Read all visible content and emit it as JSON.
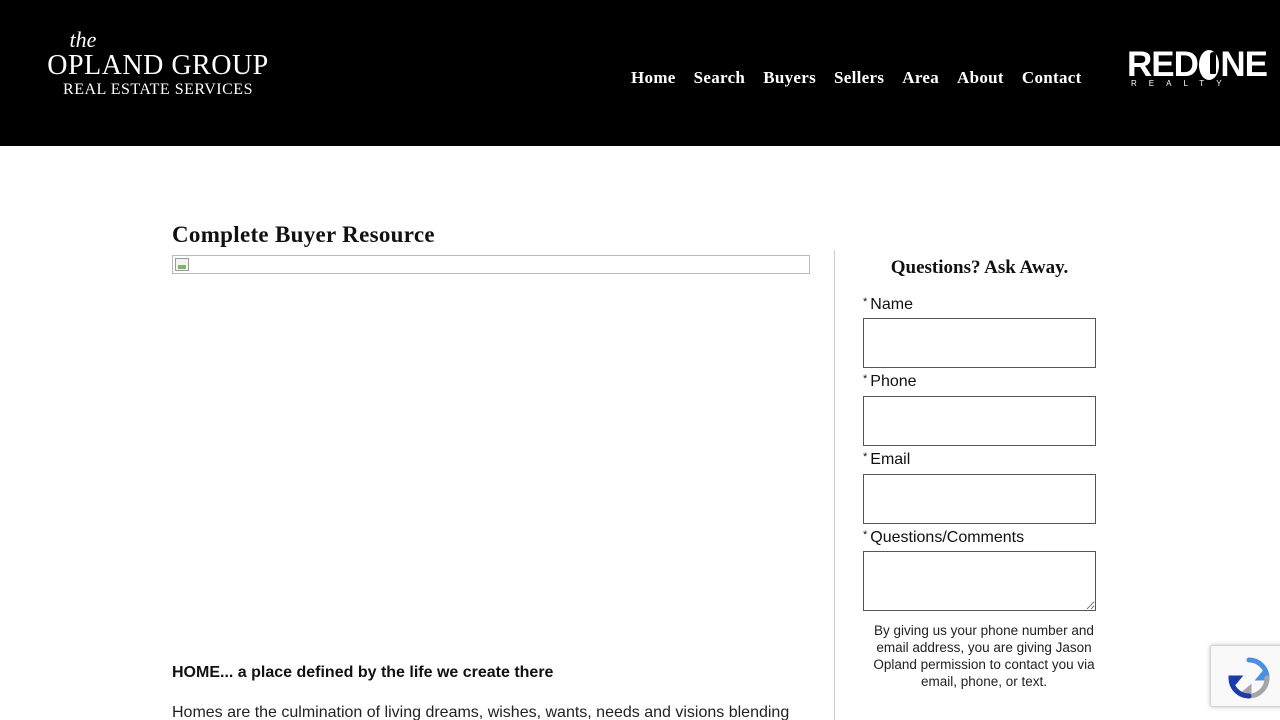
{
  "header": {
    "logo": {
      "line1": "the",
      "line2": "OPLAND GROUP",
      "line3": "REAL ESTATE SERVICES"
    },
    "nav": [
      {
        "label": "Home"
      },
      {
        "label": "Search"
      },
      {
        "label": "Buyers"
      },
      {
        "label": "Sellers"
      },
      {
        "label": "Area"
      },
      {
        "label": "About"
      },
      {
        "label": "Contact"
      }
    ],
    "brand": {
      "word_left": "RED",
      "word_right": "NE",
      "sub": "REALTY"
    }
  },
  "main": {
    "title": "Complete Buyer Resource",
    "heading": "HOME... a place defined by the life we create there",
    "paragraph": "Homes are the culmination of living dreams, wishes, wants, needs and visions blending"
  },
  "sidebar": {
    "title": "Questions? Ask Away.",
    "required_marker": "*",
    "fields": [
      {
        "label": "Name",
        "value": ""
      },
      {
        "label": "Phone",
        "value": ""
      },
      {
        "label": "Email",
        "value": ""
      },
      {
        "label": "Questions/Comments",
        "value": ""
      }
    ],
    "consent": "By giving us your phone number and email address, you are giving Jason Opland permission to contact you via email, phone, or text."
  },
  "colors": {
    "header_bg": "#000000",
    "text": "#111111",
    "border": "#555555"
  },
  "icons": [
    "broken-image-icon",
    "recaptcha-icon"
  ]
}
